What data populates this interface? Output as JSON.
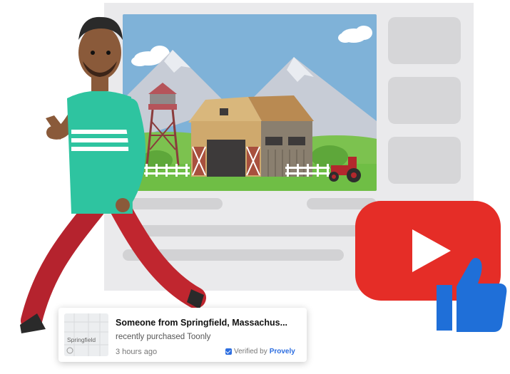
{
  "notification": {
    "title": "Someone from Springfield, Massachus...",
    "subtitle": "recently purchased Toonly",
    "time": "3 hours ago",
    "verified_label": "Verified by",
    "brand": "Provely",
    "map_label": "Springfield"
  },
  "colors": {
    "youtube_red": "#e52d27",
    "thumb_blue": "#1f6fd8",
    "shirt_teal": "#2ec4a0",
    "pants_red": "#b5232e",
    "sky_blue": "#7fb2d8",
    "grass_green": "#6fc04a"
  },
  "icons": [
    "youtube-play-icon",
    "thumbs-up-icon",
    "verified-check-icon",
    "map-pin-icon"
  ]
}
